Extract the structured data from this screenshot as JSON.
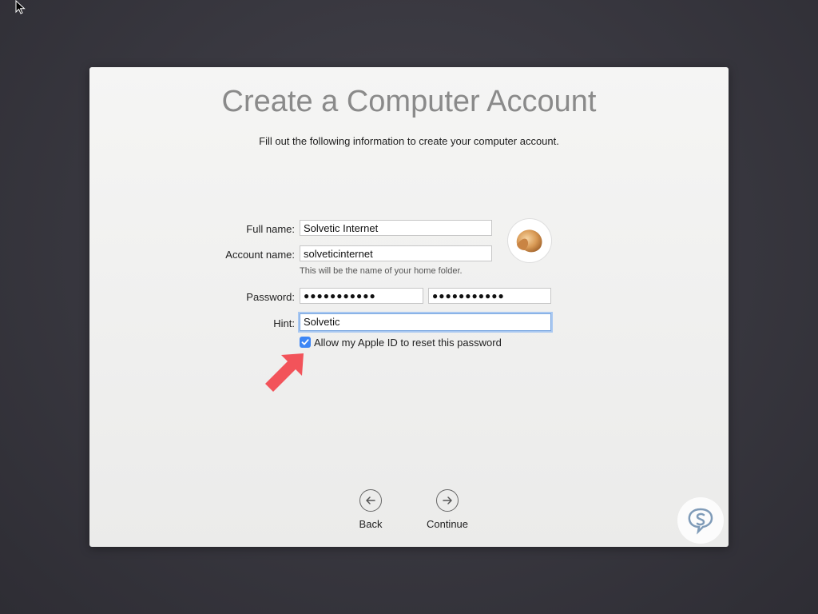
{
  "screen": {
    "title": "Create a Computer Account",
    "subtitle": "Fill out the following information to create your computer account."
  },
  "form": {
    "full_name": {
      "label": "Full name:",
      "value": "Solvetic Internet"
    },
    "account_name": {
      "label": "Account name:",
      "value": "solveticinternet",
      "note": "This will be the name of your home folder."
    },
    "password": {
      "label": "Password:",
      "value": "●●●●●●●●●●●",
      "verify_value": "●●●●●●●●●●●"
    },
    "hint": {
      "label": "Hint:",
      "value": "Solvetic"
    },
    "apple_id_reset": {
      "label": "Allow my Apple ID to reset this password",
      "checked": true
    }
  },
  "nav": {
    "back_label": "Back",
    "continue_label": "Continue"
  },
  "colors": {
    "checkbox_accent": "#3d86f5",
    "annotation_arrow": "#f2535a",
    "focus_ring": "#a9c8f1"
  },
  "icons": {
    "avatar": "fortune-cookie-icon",
    "back": "arrow-left-circle-icon",
    "continue": "arrow-right-circle-icon",
    "watermark": "solvetic-logo-icon"
  }
}
